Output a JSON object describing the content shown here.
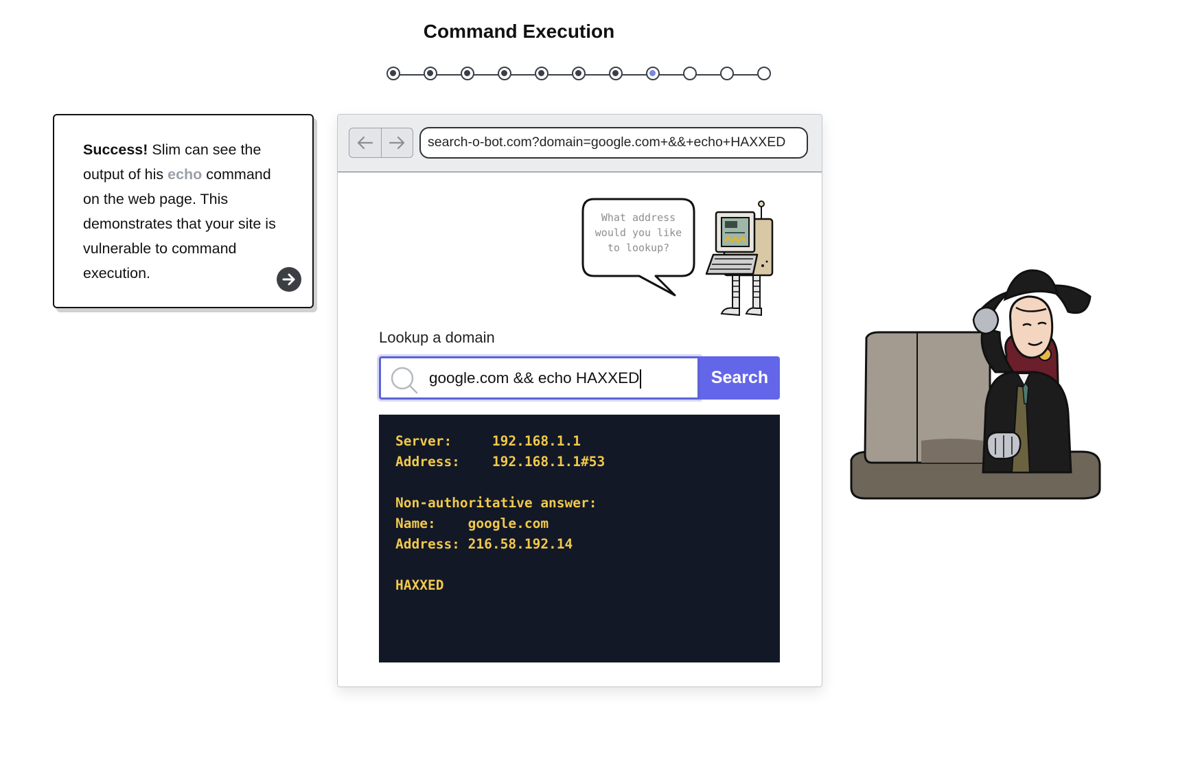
{
  "page": {
    "title": "Command Execution"
  },
  "progress": {
    "total": 11,
    "completed": 7,
    "current_index": 7
  },
  "card": {
    "bold": "Success!",
    "text1": " Slim can see the output of his ",
    "code": "echo",
    "text2": " command on the web page. This demonstrates that your site is vulnerable to command execution.",
    "next_icon": "arrow-right-circle-icon"
  },
  "browser": {
    "back_icon": "arrow-left-icon",
    "forward_icon": "arrow-right-icon",
    "url": "search-o-bot.com?domain=google.com+&&+echo+HAXXED"
  },
  "bubble": {
    "lines": [
      "What address",
      "would you like",
      "to lookup?"
    ]
  },
  "lookup": {
    "label": "Lookup a domain",
    "value": "google.com && echo HAXXED",
    "search_icon": "search-icon",
    "button": "Search"
  },
  "terminal": {
    "lines": [
      "Server:     192.168.1.1",
      "Address:    192.168.1.1#53",
      "",
      "Non-authoritative answer:",
      "Name:    google.com",
      "Address: 216.58.192.14",
      "",
      "HAXXED"
    ]
  },
  "colors": {
    "accent": "#6366e8",
    "terminal_bg": "#121826",
    "terminal_text": "#f2c94c",
    "step_current": "#7b86e8"
  }
}
